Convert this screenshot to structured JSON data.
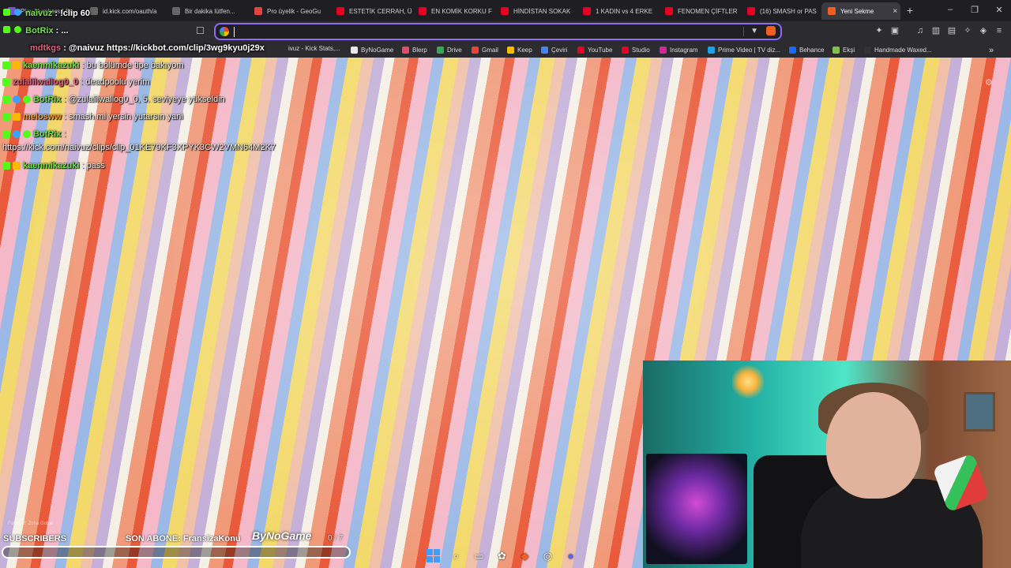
{
  "tabs": [
    {
      "label": "Play Numbers | Sa",
      "color": "#7a52d6"
    },
    {
      "label": "id.kick.com/oauth/a",
      "color": "#666666"
    },
    {
      "label": "Bir dakika lütfen...",
      "color": "#666666"
    },
    {
      "label": "Pro üyelik - GeoGu",
      "color": "#e24343"
    },
    {
      "label": "ESTETİK CERRAH, Ü",
      "color": "#e60023"
    },
    {
      "label": "EN KOMİK KORKU F",
      "color": "#e60023"
    },
    {
      "label": "HİNDİSTAN SOKAK",
      "color": "#e60023"
    },
    {
      "label": "1 KADIN vs 4 ERKE",
      "color": "#e60023"
    },
    {
      "label": "FENOMEN ÇİFTLER",
      "color": "#e60023"
    },
    {
      "label": "(16) SMASH or PAS",
      "color": "#e60023"
    },
    {
      "label": "Yeni Sekme",
      "color": "#f25d22",
      "active": true
    }
  ],
  "tab_close_glyph": "×",
  "new_tab_glyph": "+",
  "window_controls": {
    "minimize": "–",
    "restore": "❐",
    "close": "✕"
  },
  "overlay_top": {
    "line1_user": "naivuz",
    "line1_text": ": !clip 60",
    "line2_user": "BotRix",
    "line2_text": ": ...",
    "line3_user": "mdtkgs",
    "line3_text": ": @naivuz https://kickbot.com/clip/3wg9kyu0j29x",
    "line3_tail": "ivuz - Kick Stats,..."
  },
  "bookmarks": [
    {
      "label": "ByNoGame",
      "color": "#e8e8e8"
    },
    {
      "label": "Blerp",
      "color": "#e24b6a"
    },
    {
      "label": "Drive",
      "color": "#34a853"
    },
    {
      "label": "Gmail",
      "color": "#ea4335"
    },
    {
      "label": "Keep",
      "color": "#fbbc05"
    },
    {
      "label": "Çeviri",
      "color": "#4285f4"
    },
    {
      "label": "YouTube",
      "color": "#e60023"
    },
    {
      "label": "Studio",
      "color": "#e60023"
    },
    {
      "label": "Instagram",
      "color": "#d6249f"
    },
    {
      "label": "Prime Video | TV diz...",
      "color": "#1aa3e8"
    },
    {
      "label": "Behance",
      "color": "#1769ff"
    },
    {
      "label": "Ekşi",
      "color": "#81c14b"
    },
    {
      "label": "Handmade Waxed...",
      "color": "#333333"
    }
  ],
  "bookmarks_more_glyph": "»",
  "chat": [
    {
      "user": "kaenmikazuki",
      "color": "#72e34b",
      "text": "bu bölümde tipe bakıyom"
    },
    {
      "user": "zulalilwallog0_0",
      "color": "#e0607a",
      "text": "deadpoolu yerim"
    },
    {
      "user": "BotRix",
      "color": "#72e34b",
      "text": "@zulalilwallog0_0, 5. seviyeye yükseldin"
    },
    {
      "user": "melosww",
      "color": "#f3a13a",
      "text": "smash mi yersin yutarsın yani"
    },
    {
      "user": "BotRix",
      "color": "#72e34b",
      "text": ""
    },
    {
      "user": "kaenmikazuki",
      "color": "#72e34b",
      "text": "pass"
    }
  ],
  "chat_separator": ":",
  "chat_url": "https://kick.com/naivuz/clips/clip_01KE79KF3XPYK3CW2VMN64M2K7",
  "bottom": {
    "subscribers_label": "SUBSCRIBERS",
    "last_sub": "SON ABONE: FransizaKonu",
    "logo": "ByNoGame",
    "counter": "0 / 7",
    "progress_fraction": 0.0,
    "progress_color": "#53fc18",
    "credit": "Fotoğraf: Zoha Gohar"
  },
  "icons": {
    "bookmark": "☐",
    "shield": "▼",
    "gear": "⚙",
    "search": "⌕",
    "menu": "≡"
  }
}
